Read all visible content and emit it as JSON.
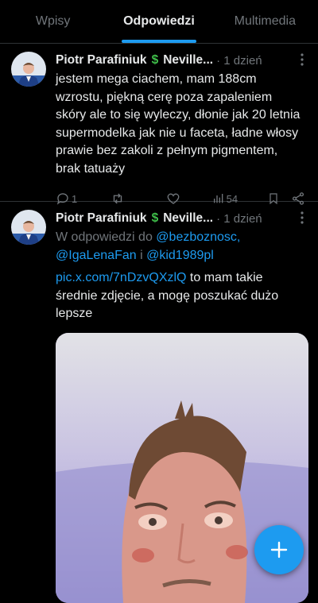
{
  "tabs": [
    {
      "label": "Wpisy",
      "active": false
    },
    {
      "label": "Odpowiedzi",
      "active": true
    },
    {
      "label": "Multimedia",
      "active": false
    }
  ],
  "tweets": [
    {
      "author": "Piotr Parafiniuk",
      "badge": "$",
      "author2": "Neville...",
      "time": "· 1 dzień",
      "text": "jestem mega ciachem, mam 188cm wzrostu, piękną cerę poza zapaleniem skóry ale to się wyleczy, dłonie jak 20 letnia supermodelka jak nie u faceta, ładne włosy prawie bez zakoli z pełnym pigmentem, brak tatuaży",
      "stats": {
        "replies": "1",
        "reposts": "",
        "likes": "",
        "views": "54"
      }
    },
    {
      "author": "Piotr Parafiniuk",
      "badge": "$",
      "author2": "Neville...",
      "time": "· 1 dzień",
      "reply_prefix": "W odpowiedzi do",
      "mention1": "@bezboznosc,",
      "mention2": "@IgaLenaFan",
      "reply_and": " i ",
      "mention3": "@kid1989pl",
      "link": "pic.x.com/7nDzvQXzlQ",
      "text": " to mam takie średnie zdjęcie, a mogę poszukać dużo lepsze"
    }
  ],
  "colors": {
    "accent": "#1d9bf0",
    "muted": "#71767b",
    "money": "#3fbf4a"
  },
  "icons": [
    "reply-icon",
    "repost-icon",
    "like-icon",
    "views-icon",
    "bookmark-icon",
    "share-icon",
    "more-icon",
    "compose-icon"
  ]
}
